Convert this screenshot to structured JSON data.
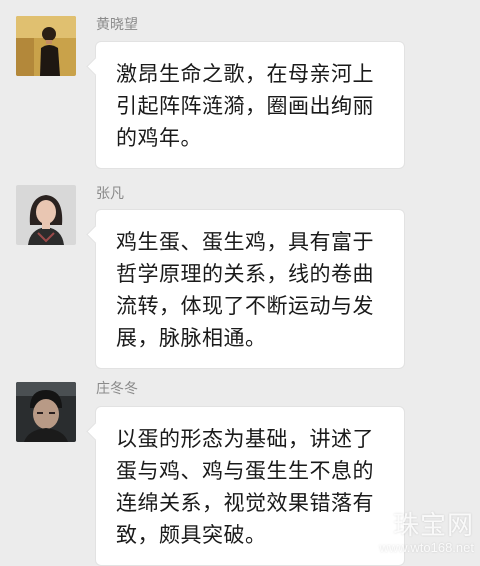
{
  "messages": [
    {
      "sender": "黄晓望",
      "avatar_icon": "avatar-man-standing-icon",
      "text": "激昂生命之歌，在母亲河上引起阵阵涟漪，圈画出绚丽的鸡年。"
    },
    {
      "sender": "张凡",
      "avatar_icon": "avatar-woman-portrait-icon",
      "text": "鸡生蛋、蛋生鸡，具有富于哲学原理的关系，线的卷曲流转，体现了不断运动与发展，脉脉相通。"
    },
    {
      "sender": "庄冬冬",
      "avatar_icon": "avatar-man-portrait-icon",
      "text": "以蛋的形态为基础，讲述了蛋与鸡、鸡与蛋生生不息的连绵关系，视觉效果错落有致，颇具突破。"
    }
  ],
  "watermark": {
    "title": "珠宝网",
    "url": "www.wto168.net"
  },
  "colors": {
    "background": "#ececec",
    "bubble": "#ffffff",
    "sender_text": "#8a8a8a",
    "message_text": "#1a1a1a"
  }
}
